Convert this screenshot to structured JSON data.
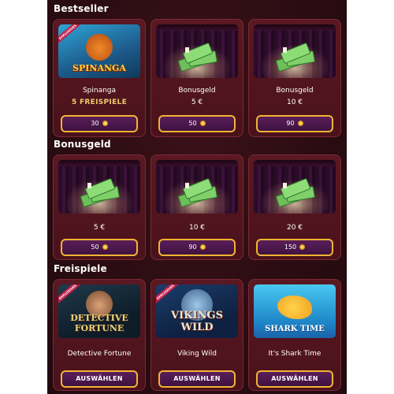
{
  "sections": {
    "bestseller": {
      "title": "Bestseller",
      "cards": [
        {
          "title": "Spinanga",
          "subtitle": "5 FREISPIELE",
          "button": "30",
          "thumb_logo": "SPINANGA",
          "thumb_badge": "EXKLUSIVES"
        },
        {
          "title": "Bonusgeld",
          "subtitle": "5 €",
          "button": "50"
        },
        {
          "title": "Bonusgeld",
          "subtitle": "10 €",
          "button": "90"
        }
      ]
    },
    "bonusgeld": {
      "title": "Bonusgeld",
      "cards": [
        {
          "value": "5 €",
          "button": "50"
        },
        {
          "value": "10 €",
          "button": "90"
        },
        {
          "value": "20 €",
          "button": "150"
        }
      ]
    },
    "freispiele": {
      "title": "Freispiele",
      "cards": [
        {
          "title": "Detective Fortune",
          "button": "AUSWÄHLEN",
          "thumb_logo": "DETECTIVE FORTUNE",
          "thumb_badge": "EXKLUSIVES"
        },
        {
          "title": "Viking Wild",
          "button": "AUSWÄHLEN",
          "thumb_logo": "VIKINGS WILD",
          "thumb_badge": "EXKLUSIVES"
        },
        {
          "title": "It's Shark Time",
          "button": "AUSWÄHLEN",
          "thumb_logo": "SHARK TIME"
        }
      ]
    }
  },
  "icons": {
    "coin": "coin-icon",
    "money": "money-stack-icon"
  },
  "colors": {
    "background": "#2a0c12",
    "card": "#4a121b",
    "button_border": "#f2b431",
    "button_fill": "#4a1648",
    "accent_text": "#f0c96a"
  }
}
